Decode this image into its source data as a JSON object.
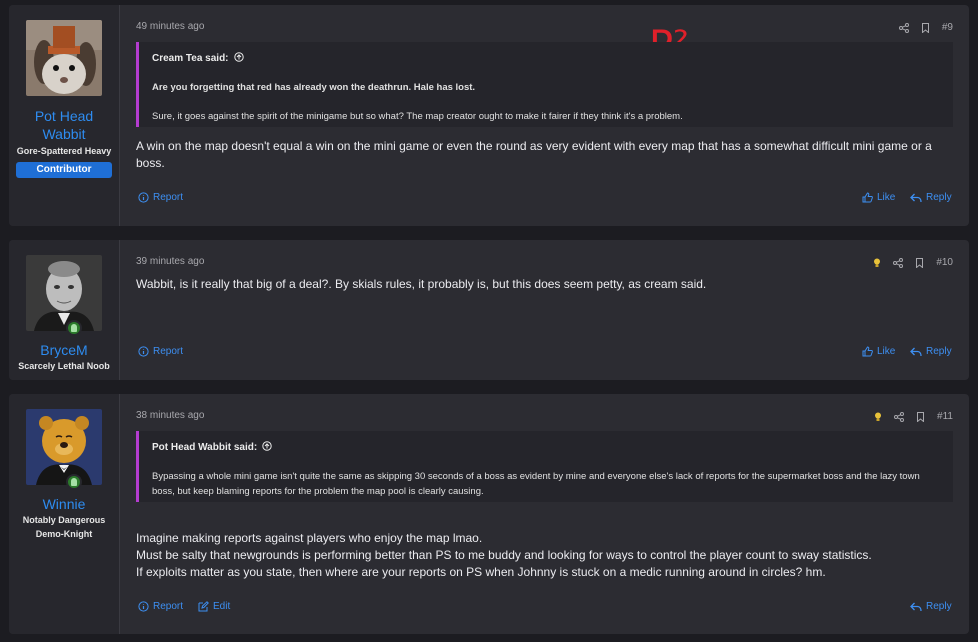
{
  "posts": [
    {
      "username": "Pot Head Wabbit",
      "user_title": "Gore-Spattered Heavy",
      "badge": "Contributor",
      "time": "49 minutes ago",
      "number": "#9",
      "quote_author": "Cream Tea said:",
      "quote_lines": [
        "Are you forgetting that red has already won the deathrun. Hale has lost.",
        "Sure, it goes against the spirit of the minigame but so what? The map creator ought to make it fairer if they think it's a problem."
      ],
      "body": "A win on the map doesn't equal a win on the mini game or even the round as very evident with every map that has a somewhat difficult mini game or a boss.",
      "report": "Report",
      "like": "Like",
      "reply": "Reply",
      "annotation": "P²"
    },
    {
      "username": "BryceM",
      "user_title": "Scarcely Lethal Noob",
      "time": "39 minutes ago",
      "number": "#10",
      "body": "Wabbit, is it really that big of a deal?. By skials rules, it probably is, but this does seem petty, as cream said.",
      "report": "Report",
      "like": "Like",
      "reply": "Reply"
    },
    {
      "username": "Winnie",
      "user_title_1": "Notably Dangerous",
      "user_title_2": "Demo-Knight",
      "time": "38 minutes ago",
      "number": "#11",
      "quote_author": "Pot Head Wabbit said:",
      "quote_text": "Bypassing a whole mini game isn't quite the same as skipping 30 seconds of a boss as evident by mine and everyone else's lack of reports for the supermarket boss and the lazy town boss, but keep blaming reports for the problem the map pool is clearly causing.",
      "body_lines": [
        "Imagine making reports against players who enjoy the map lmao.",
        "Must be salty that newgrounds is performing better than PS to me buddy and looking for ways to control the player count to sway statistics.",
        "If exploits matter as you state, then where are your reports on PS when Johnny is stuck on a medic running around in circles? hm."
      ],
      "report": "Report",
      "edit": "Edit",
      "reply": "Reply"
    }
  ],
  "colors": {
    "accent": "#3d8ff2",
    "quote_bar": "#b43cd0",
    "badge": "#1f6fd6",
    "annotation": "#e0202a"
  }
}
